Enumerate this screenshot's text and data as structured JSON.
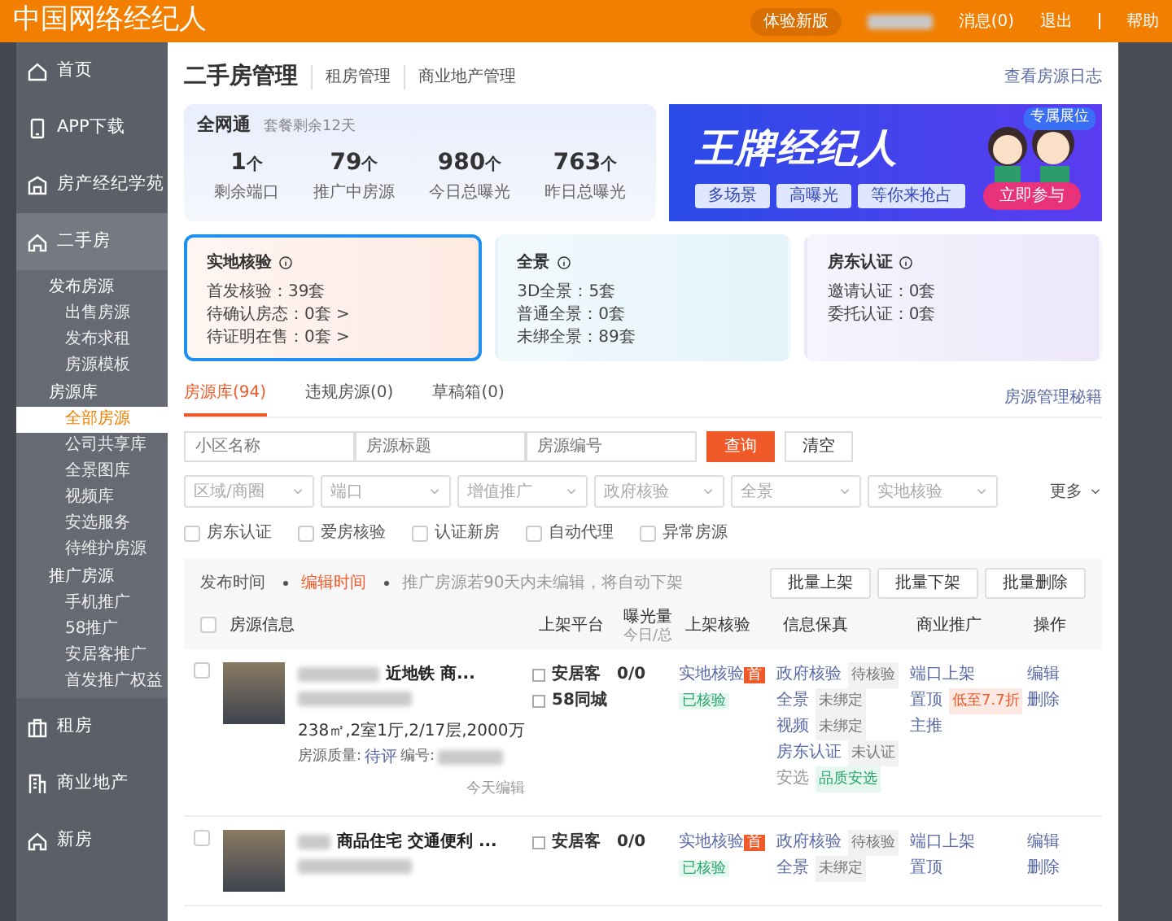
{
  "topbar": {
    "logo": "中国网络经纪人",
    "new_version": "体验新版",
    "links": [
      "消息(0)",
      "退出",
      "帮助"
    ]
  },
  "sidebar": {
    "items": [
      {
        "label": "首页",
        "kind": "home",
        "selected": false
      },
      {
        "label": "APP下载",
        "kind": "phone",
        "selected": false
      },
      {
        "label": "房产经纪学苑",
        "kind": "school",
        "selected": false
      },
      {
        "label": "二手房",
        "kind": "house",
        "selected": false,
        "expanded": true,
        "children": [
          {
            "label": "发布房源",
            "children": [
              {
                "label": "出售房源",
                "selected": false
              },
              {
                "label": "发布求租",
                "selected": false
              },
              {
                "label": "房源模板",
                "selected": false
              }
            ]
          },
          {
            "label": "房源库",
            "children": [
              {
                "label": "全部房源",
                "selected": true
              },
              {
                "label": "公司共享库",
                "selected": false
              },
              {
                "label": "全景图库",
                "selected": false
              },
              {
                "label": "视频库",
                "selected": false
              },
              {
                "label": "安选服务",
                "selected": false
              },
              {
                "label": "待维护房源",
                "selected": false
              }
            ]
          },
          {
            "label": "推广房源",
            "children": [
              {
                "label": "手机推广",
                "selected": false
              },
              {
                "label": "58推广",
                "selected": false
              },
              {
                "label": "安居客推广",
                "selected": false
              },
              {
                "label": "首发推广权益",
                "selected": false
              }
            ]
          }
        ]
      },
      {
        "label": "租房",
        "kind": "bag",
        "selected": false
      },
      {
        "label": "商业地产",
        "kind": "office",
        "selected": false
      },
      {
        "label": "新房",
        "kind": "house",
        "selected": false
      }
    ]
  },
  "header": {
    "title": "二手房管理",
    "tabs": [
      "租房管理",
      "商业地产管理"
    ],
    "log_link": "查看房源日志"
  },
  "package": {
    "title": "全网通",
    "subtitle": "套餐剩余12天",
    "stats": [
      {
        "value": "1",
        "unit": "个",
        "label": "剩余端口"
      },
      {
        "value": "79",
        "unit": "个",
        "label": "推广中房源"
      },
      {
        "value": "980",
        "unit": "个",
        "label": "今日总曝光"
      },
      {
        "value": "763",
        "unit": "个",
        "label": "昨日总曝光"
      }
    ]
  },
  "banner": {
    "badge": "专属展位",
    "title": "王牌经纪人",
    "slogans": [
      "多场景",
      "高曝光",
      "等你来抢占"
    ],
    "button": "立即参与"
  },
  "feature_cards": [
    {
      "title": "实地核验",
      "selected": true,
      "kind": "check",
      "lines": [
        "首发核验：39套",
        "待确认房态：0套 >",
        "待证明在售：0套 >"
      ]
    },
    {
      "title": "全景",
      "selected": false,
      "kind": "pano",
      "lines": [
        "3D全景：5套",
        "普通全景：0套",
        "未绑全景：89套"
      ]
    },
    {
      "title": "房东认证",
      "selected": false,
      "kind": "owner",
      "lines": [
        "邀请认证：0套",
        "委托认证：0套"
      ]
    }
  ],
  "list_tabs": [
    {
      "label": "房源库(94)",
      "selected": true
    },
    {
      "label": "违规房源(0)",
      "selected": false
    },
    {
      "label": "草稿箱(0)",
      "selected": false
    }
  ],
  "tips_link": "房源管理秘籍",
  "search": {
    "fields": [
      {
        "placeholder": "小区名称"
      },
      {
        "placeholder": "房源标题"
      },
      {
        "placeholder": "房源编号"
      }
    ],
    "buttons": [
      {
        "label": "查询",
        "kind": "primary"
      },
      {
        "label": "清空",
        "kind": "plain"
      }
    ]
  },
  "selects": [
    {
      "placeholder": "区域/商圈"
    },
    {
      "placeholder": "端口"
    },
    {
      "placeholder": "增值推广"
    },
    {
      "placeholder": "政府核验"
    },
    {
      "placeholder": "全景"
    },
    {
      "placeholder": "实地核验"
    }
  ],
  "more": "更多",
  "checkboxes": [
    {
      "label": "房东认证",
      "checked": false
    },
    {
      "label": "爱房核验",
      "checked": false
    },
    {
      "label": "认证新房",
      "checked": false
    },
    {
      "label": "自动代理",
      "checked": false
    },
    {
      "label": "异常房源",
      "checked": false
    }
  ],
  "sorts": [
    {
      "label": "发布时间",
      "selected": false
    },
    {
      "label": "编辑时间",
      "selected": true
    }
  ],
  "sort_note": "推广房源若90天内未编辑，将自动下架",
  "batch_buttons": [
    "批量上架",
    "批量下架",
    "批量删除"
  ],
  "table": {
    "select_all_checked": false,
    "columns": [
      {
        "label": "房源信息"
      },
      {
        "label": "上架平台"
      },
      {
        "label": "曝光量",
        "sub": "今日/总"
      },
      {
        "label": "上架核验"
      },
      {
        "label": "信息保真"
      },
      {
        "label": "商业推广"
      },
      {
        "label": "操作"
      }
    ],
    "rows": [
      {
        "checked": false,
        "title": "近地铁 商...",
        "specs": "238㎡,2室1厅,2/17层,2000万",
        "quality_label": "房源质量:",
        "quality": "待评",
        "number_label": "编号:",
        "edited": "今天编辑",
        "platforms": [
          {
            "name": "安居客",
            "checked": false
          },
          {
            "name": "58同城",
            "checked": false
          }
        ],
        "exposure": "0/0",
        "check": "实地核验",
        "check_badge": "首",
        "check_status": "已核验",
        "info": [
          {
            "label": "政府核验",
            "tag": "待核验",
            "kind": "gray"
          },
          {
            "label": "全景",
            "tag": "未绑定",
            "kind": "gray"
          },
          {
            "label": "视频",
            "tag": "未绑定",
            "kind": "gray"
          },
          {
            "label": "房东认证",
            "tag": "未认证",
            "kind": "gray"
          },
          {
            "label": "安选",
            "tag": "品质安选",
            "kind": "green"
          }
        ],
        "promotion": [
          {
            "label": "端口上架"
          },
          {
            "label": "置顶",
            "tag": "低至7.7折"
          },
          {
            "label": "主推"
          }
        ],
        "actions": [
          "编辑",
          "删除"
        ]
      },
      {
        "checked": false,
        "title": "商品住宅 交通便利 ...",
        "platforms": [
          {
            "name": "安居客",
            "checked": false
          }
        ],
        "exposure": "0/0",
        "check": "实地核验",
        "check_badge": "首",
        "check_status": "已核验",
        "info": [
          {
            "label": "政府核验",
            "tag": "待核验",
            "kind": "gray"
          },
          {
            "label": "全景",
            "tag": "未绑定",
            "kind": "gray"
          }
        ],
        "promotion": [
          {
            "label": "端口上架"
          },
          {
            "label": "置顶"
          }
        ],
        "actions": [
          "编辑",
          "删除"
        ]
      }
    ]
  }
}
